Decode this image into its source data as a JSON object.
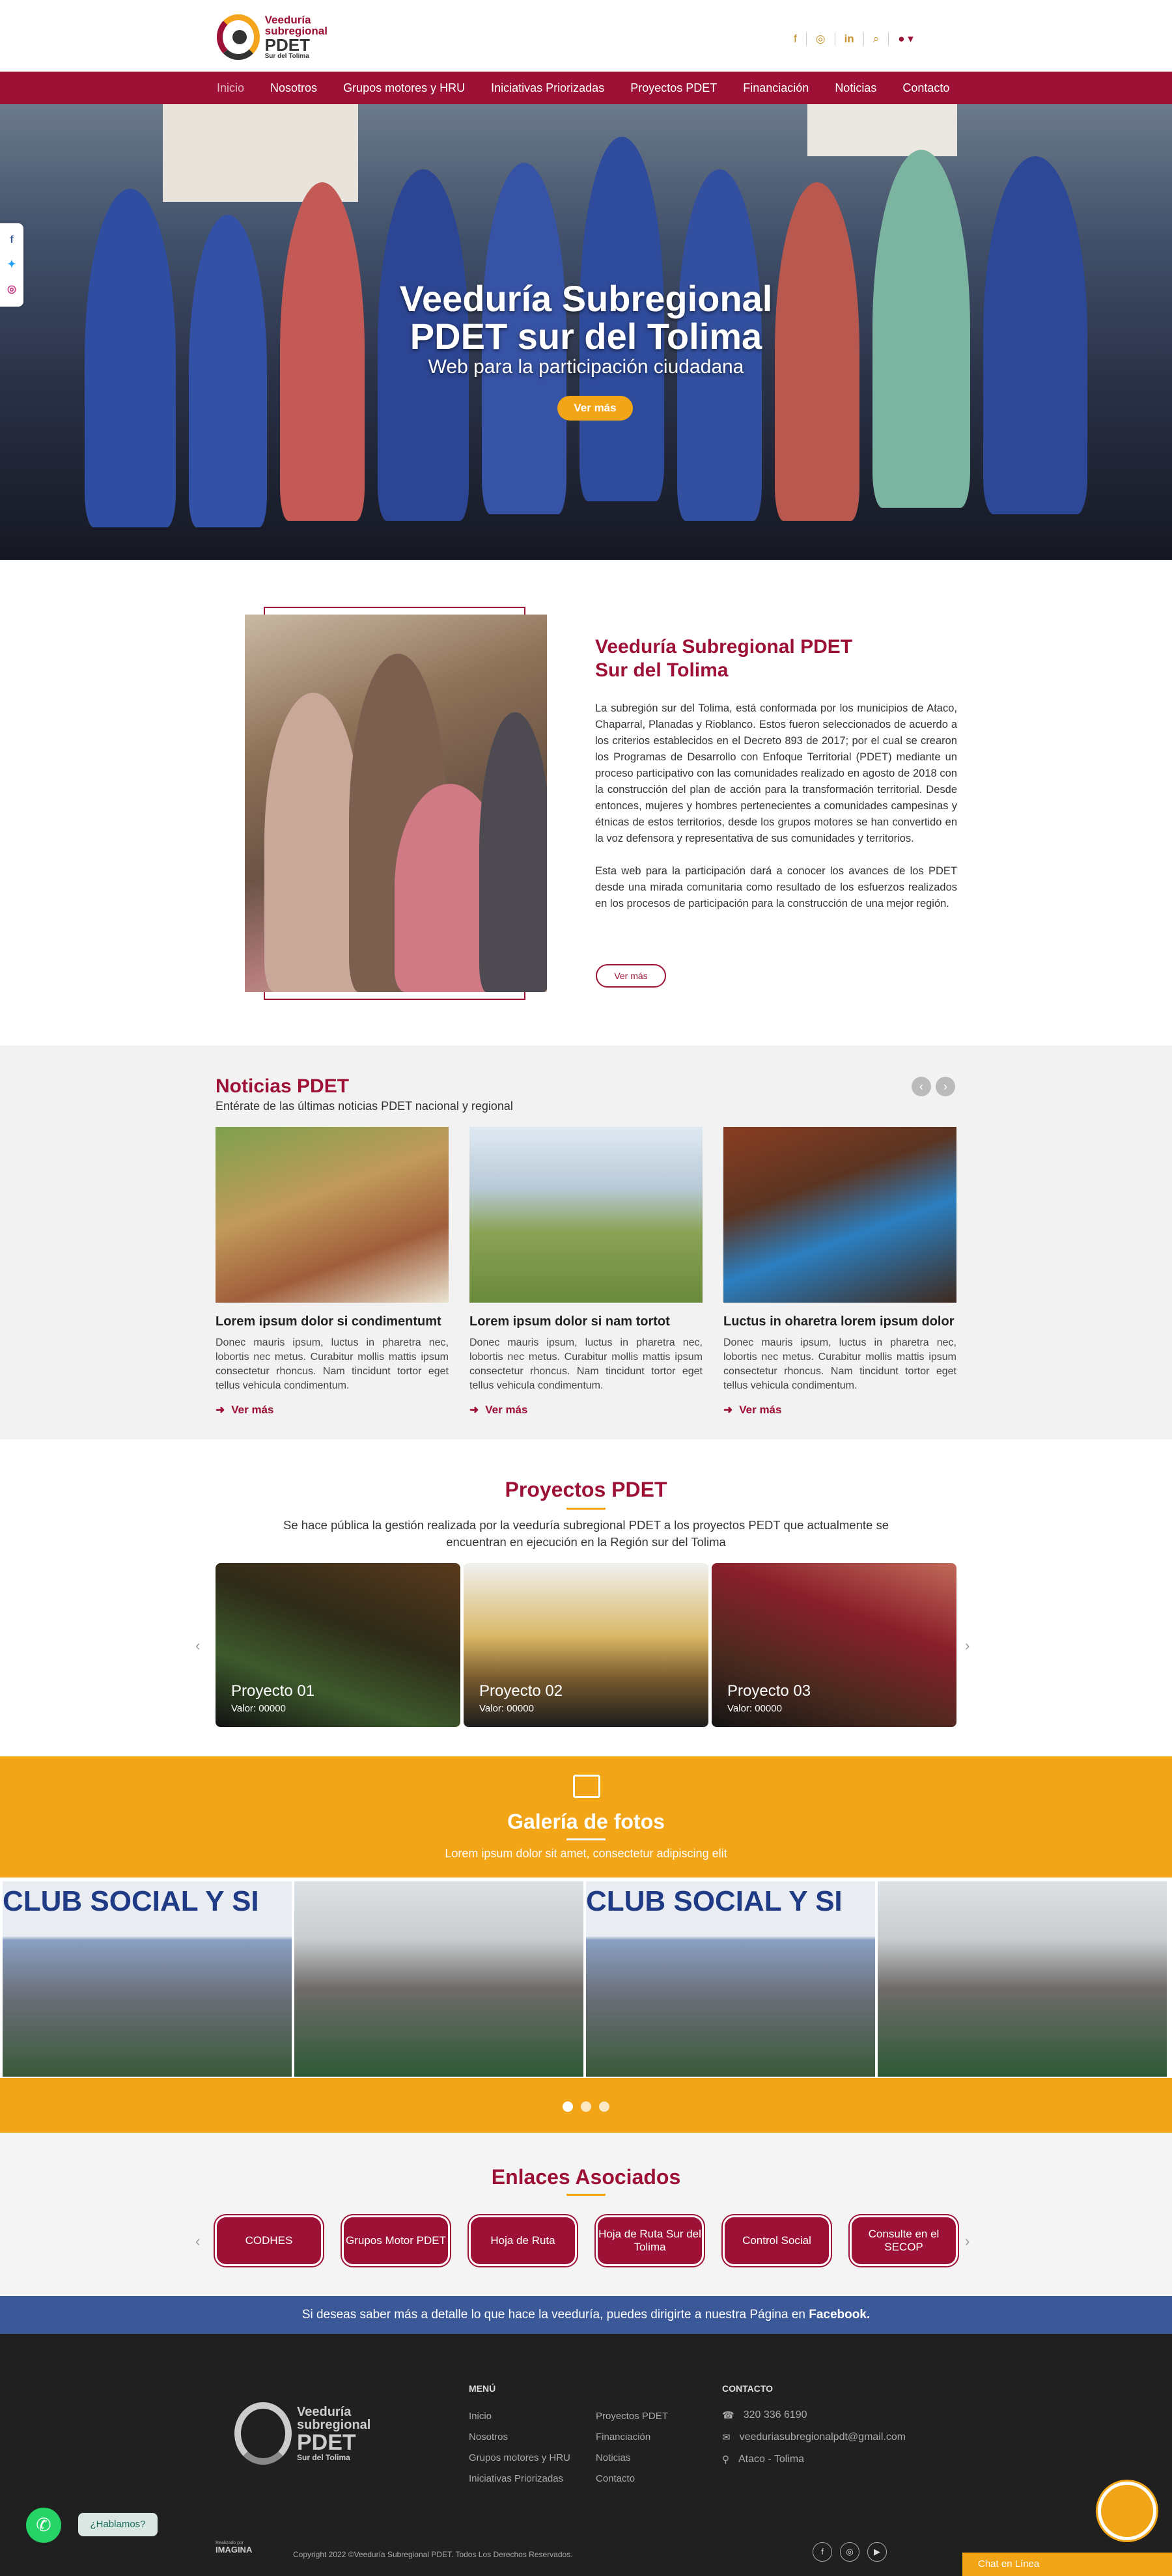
{
  "header": {
    "logo_lines": [
      "Veeduría",
      "subregional",
      "PDET",
      "Sur del Tolima"
    ],
    "icons": [
      "facebook-icon",
      "instagram-icon",
      "linkedin-icon",
      "search-icon",
      "user-icon"
    ]
  },
  "nav": {
    "items": [
      "Inicio",
      "Nosotros",
      "Grupos motores y HRU",
      "Iniciativas Priorizadas",
      "Proyectos PDET",
      "Financiación",
      "Noticias",
      "Contacto"
    ],
    "active": "Inicio"
  },
  "hero": {
    "title_line1": "Veeduría Subregional",
    "title_line2": "PDET sur del Tolima",
    "subtitle": "Web para la participación ciudadana",
    "button": "Ver más"
  },
  "social_side": [
    "facebook-icon",
    "twitter-icon",
    "instagram-icon"
  ],
  "about": {
    "title_line1": "Veeduría Subregional PDET",
    "title_line2": "Sur del Tolima",
    "paragraph1": "La subregión sur del Tolima, está conformada por los municipios de Ataco, Chaparral, Planadas y Rioblanco. Estos fueron seleccionados de acuerdo a los criterios establecidos en el Decreto 893 de 2017; por el cual se crearon los Programas de Desarrollo con Enfoque Territorial (PDET) mediante un proceso participativo con las comunidades realizado en agosto de 2018 con la construcción del plan de acción para la transformación territorial. Desde entonces, mujeres y hombres pertenecientes a comunidades campesinas y étnicas de estos territorios, desde los grupos motores se han convertido en la voz defensora y representativa de sus comunidades y territorios.",
    "paragraph2": "Esta web para la participación dará a conocer los avances de los PDET desde una mirada comunitaria como resultado de los esfuerzos realizados en los procesos de participación para la construcción de una mejor región.",
    "button": "Ver más"
  },
  "news": {
    "title": "Noticias PDET",
    "subtitle": "Entérate de las últimas noticias PDET nacional y regional",
    "cards": [
      {
        "title": "Lorem ipsum dolor si condimentumt",
        "text": "Donec mauris ipsum, luctus in pharetra nec, lobortis nec metus. Curabitur mollis mattis ipsum consectetur rhoncus. Nam tincidunt tortor eget tellus vehicula condimentum.",
        "more": "Ver más"
      },
      {
        "title": "Lorem ipsum dolor si nam tortot",
        "text": "Donec mauris ipsum, luctus in pharetra nec, lobortis nec metus. Curabitur mollis mattis ipsum consectetur rhoncus. Nam tincidunt tortor eget tellus vehicula condimentum.",
        "more": "Ver más"
      },
      {
        "title": "Luctus in oharetra lorem ipsum dolor",
        "text": "Donec mauris ipsum, luctus in pharetra nec, lobortis nec metus. Curabitur mollis mattis ipsum consectetur rhoncus. Nam tincidunt tortor eget tellus vehicula condimentum.",
        "more": "Ver más"
      }
    ]
  },
  "projects": {
    "title": "Proyectos PDET",
    "subtitle": "Se hace pública la gestión realizada por la veeduría subregional PDET a los proyectos PEDT que actualmente se encuentran en ejecución en la Región sur del Tolima",
    "cards": [
      {
        "name": "Proyecto 01",
        "value": "Valor: 00000"
      },
      {
        "name": "Proyecto 02",
        "value": "Valor: 00000"
      },
      {
        "name": "Proyecto 03",
        "value": "Valor: 00000"
      }
    ]
  },
  "gallery": {
    "title": "Galería de fotos",
    "subtitle": "Lorem ipsum dolor sit amet, consectetur adipiscing elit",
    "banner_text": "CLUB SOCIAL Y SI"
  },
  "links": {
    "title": "Enlaces Asociados",
    "items": [
      "CODHES",
      "Grupos Motor PDET",
      "Hoja de Ruta",
      "Hoja de Ruta Sur del Tolima",
      "Control Social",
      "Consulte en el SECOP"
    ]
  },
  "facebook_band": {
    "text": "Si deseas saber más a detalle lo que hace la veeduría, puedes dirigirte a nuestra Página en ",
    "link": "Facebook."
  },
  "footer": {
    "logo_lines": [
      "Veeduría",
      "subregional",
      "PDET",
      "Sur del Tolima"
    ],
    "menu_title": "MENÚ",
    "menu_col1": [
      "Inicio",
      "Nosotros",
      "Grupos motores y HRU",
      "Iniciativas Priorizadas"
    ],
    "menu_col2": [
      "Proyectos PDET",
      "Financiación",
      "Noticias",
      "Contacto"
    ],
    "contact_title": "CONTACTO",
    "phone": "320 336 6190",
    "email": "veeduriasubregionalpdt@gmail.com",
    "location": "Ataco - Tolima",
    "credit_small": "Realizado por",
    "credit_brand": "IMAGINA",
    "copyright": "Copyright 2022 ©Veeduría Subregional PDET. Todos Los Derechos Reservados.",
    "social": [
      "facebook-icon",
      "instagram-icon",
      "youtube-icon"
    ]
  },
  "widgets": {
    "whatsapp_bubble": "¿Hablamos?",
    "chat_bar": "Chat en Línea"
  }
}
